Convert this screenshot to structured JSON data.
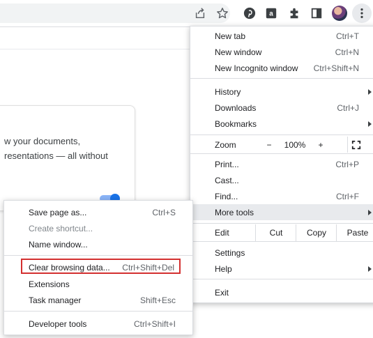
{
  "page": {
    "card_text": "w your documents,\nresentations — all without"
  },
  "colors": {
    "highlight_border": "#d32f2f",
    "menu_hover": "#e8eaed"
  },
  "main_menu": {
    "new_tab": {
      "label": "New tab",
      "shortcut": "Ctrl+T"
    },
    "new_window": {
      "label": "New window",
      "shortcut": "Ctrl+N"
    },
    "new_incognito": {
      "label": "New Incognito window",
      "shortcut": "Ctrl+Shift+N"
    },
    "history": {
      "label": "History"
    },
    "downloads": {
      "label": "Downloads",
      "shortcut": "Ctrl+J"
    },
    "bookmarks": {
      "label": "Bookmarks"
    },
    "zoom": {
      "label": "Zoom",
      "minus": "−",
      "value": "100%",
      "plus": "+"
    },
    "print": {
      "label": "Print...",
      "shortcut": "Ctrl+P"
    },
    "cast": {
      "label": "Cast..."
    },
    "find": {
      "label": "Find...",
      "shortcut": "Ctrl+F"
    },
    "more_tools": {
      "label": "More tools"
    },
    "edit": {
      "label": "Edit",
      "cut": "Cut",
      "copy": "Copy",
      "paste": "Paste"
    },
    "settings": {
      "label": "Settings"
    },
    "help": {
      "label": "Help"
    },
    "exit": {
      "label": "Exit"
    }
  },
  "sub_menu": {
    "save_page": {
      "label": "Save page as...",
      "shortcut": "Ctrl+S"
    },
    "create_shortcut": {
      "label": "Create shortcut..."
    },
    "name_window": {
      "label": "Name window..."
    },
    "clear_browsing": {
      "label": "Clear browsing data...",
      "shortcut": "Ctrl+Shift+Del"
    },
    "extensions": {
      "label": "Extensions"
    },
    "task_manager": {
      "label": "Task manager",
      "shortcut": "Shift+Esc"
    },
    "developer_tools": {
      "label": "Developer tools",
      "shortcut": "Ctrl+Shift+I"
    }
  },
  "toolbar_icons": [
    "share-icon",
    "star-icon",
    "pinterest-icon",
    "extension-a-icon",
    "puzzle-icon",
    "side-panel-icon",
    "avatar",
    "kebab-menu-icon"
  ]
}
